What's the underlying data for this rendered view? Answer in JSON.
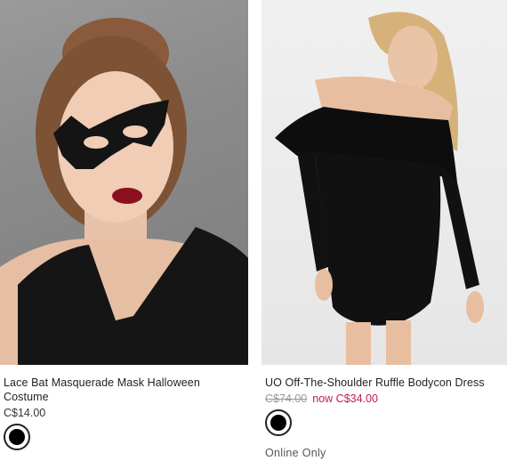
{
  "products": [
    {
      "title": "Lace Bat Masquerade Mask Halloween Costume",
      "price": "C$14.00",
      "swatch_color": "#000000",
      "image_subject": "model-wearing-lace-bat-mask"
    },
    {
      "title": "UO Off-The-Shoulder Ruffle Bodycon Dress",
      "price_old": "C$74.00",
      "price_now": "now C$34.00",
      "swatch_color": "#000000",
      "note": "Online Only",
      "image_subject": "model-wearing-black-ruffle-dress"
    }
  ],
  "colors": {
    "sale_price": "#c2185b",
    "old_price": "#999999"
  }
}
